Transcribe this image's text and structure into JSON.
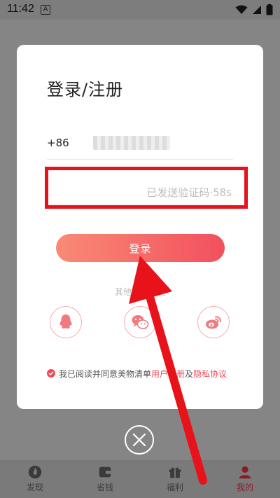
{
  "status_bar": {
    "time": "11:42",
    "notification_letter": "A"
  },
  "dialog": {
    "title": "登录/注册",
    "phone_prefix": "+86",
    "phone_value": "",
    "code_placeholder": "",
    "code_countdown": "已发送验证码·58s",
    "login_label": "登录",
    "other_methods_label": "其他登录方式",
    "social": [
      {
        "name": "qq-icon"
      },
      {
        "name": "wechat-icon"
      },
      {
        "name": "weibo-icon"
      }
    ],
    "agreement": {
      "prefix": "我已阅读并同意美物清单 ",
      "user_agreement": "用户注册",
      "conjunction": "及",
      "privacy": "隐私协议"
    }
  },
  "bottom_nav": {
    "items": [
      {
        "label": "发现"
      },
      {
        "label": "省钱"
      },
      {
        "label": "福利"
      },
      {
        "label": "我的"
      }
    ],
    "active_index": 3
  },
  "colors": {
    "accent": "#ef4a57",
    "annotation": "#e8121a",
    "overlay": "#858585"
  }
}
